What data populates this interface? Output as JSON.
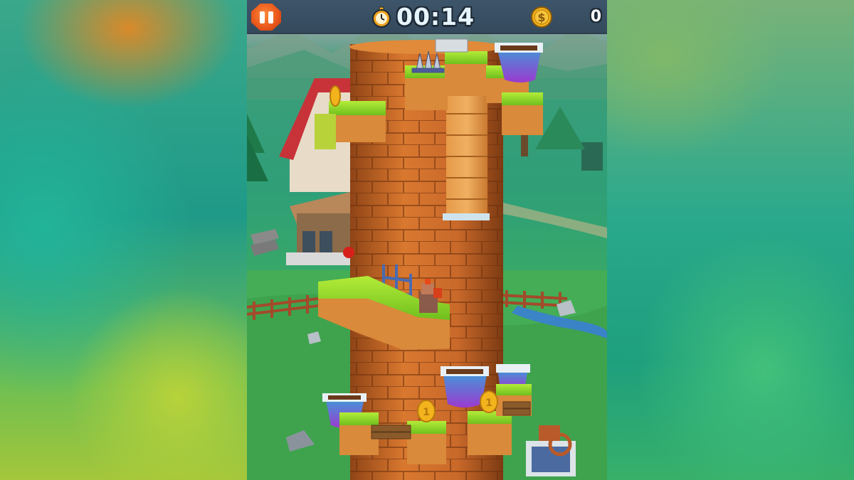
{
  "hud": {
    "pause_icon": "pause-icon",
    "timer_icon": "stopwatch-icon",
    "timer": "00:14",
    "coin_icon": "coin-icon",
    "coin_symbol": "$",
    "coins": "0"
  },
  "colors": {
    "hud_bar": "#34495c",
    "pause_button": "#e8551a",
    "tower_brick": "#c9692a",
    "grass": "#8fd42a",
    "coin": "#f2b31c"
  },
  "scene": {
    "coin_glyph": "1"
  }
}
